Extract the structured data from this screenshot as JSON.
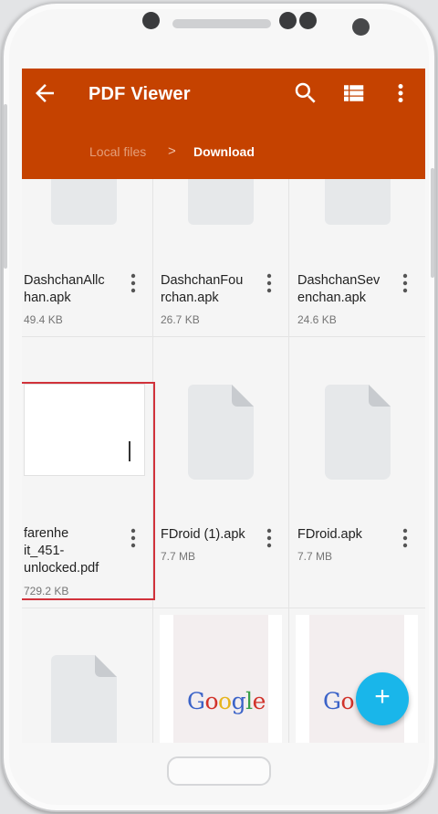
{
  "app": {
    "title": "PDF Viewer",
    "breadcrumb": {
      "parent": "Local files",
      "separator": ">",
      "current": "Download"
    },
    "actions": [
      "search-icon",
      "list-view-icon",
      "more-vert-icon"
    ]
  },
  "colors": {
    "appbar": "#c54200",
    "fab": "#19b6ea",
    "highlight": "#d1323b"
  },
  "files": [
    {
      "name": "DashchanAllchan.apk",
      "line1": "DashchanAllc",
      "line2": "han.apk",
      "size": "49.4 KB"
    },
    {
      "name": "DashchanFourchan.apk",
      "line1": "DashchanFou",
      "line2": "rchan.apk",
      "size": "26.7 KB"
    },
    {
      "name": "DashchanSevenchan.apk",
      "line1": "DashchanSev",
      "line2": "enchan.apk",
      "size": "24.6 KB"
    },
    {
      "name": "farenheit_451-unlocked.pdf",
      "line1": "farenhe",
      "line2": "it_451-",
      "line3": "unlocked.pdf",
      "size": "729.2 KB"
    },
    {
      "name": "FDroid (1).apk",
      "line1": "FDroid (1).apk",
      "size": "7.7 MB"
    },
    {
      "name": "FDroid.apk",
      "line1": "FDroid.apk",
      "size": "7.7 MB"
    }
  ],
  "google_thumbs": {
    "word": "Google",
    "partial": "Go"
  },
  "fab": {
    "label": "+"
  }
}
